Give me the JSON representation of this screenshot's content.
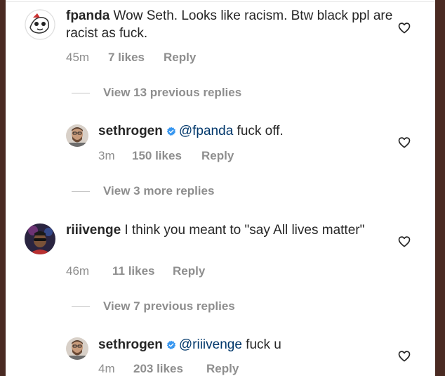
{
  "comments": [
    {
      "username": "fpanda",
      "text": " Wow Seth. Looks like racism. Btw black ppl are racist as fuck.",
      "time": "45m",
      "likes": "7 likes",
      "reply": "Reply"
    },
    {
      "username": "sethrogen",
      "mention": "@fpanda",
      "text": " fuck off.",
      "time": "3m",
      "likes": "150 likes",
      "reply": "Reply"
    },
    {
      "username": "riiivenge",
      "text": " I think you meant to \"say All lives matter\"",
      "time": "46m",
      "likes": "11 likes",
      "reply": "Reply"
    },
    {
      "username": "sethrogen",
      "mention": "@riiivenge",
      "text": " fuck u",
      "time": "4m",
      "likes": "203 likes",
      "reply": "Reply"
    }
  ],
  "view_replies": [
    "View 13 previous replies",
    "View 3 more replies",
    "View 7 previous replies"
  ],
  "colors": {
    "text": "#262626",
    "secondary": "#8e8e8e",
    "mention": "#00376b",
    "verified": "#3897f0",
    "frame": "#4a2a22"
  },
  "icons": [
    "heart-icon",
    "verified-badge-icon"
  ]
}
